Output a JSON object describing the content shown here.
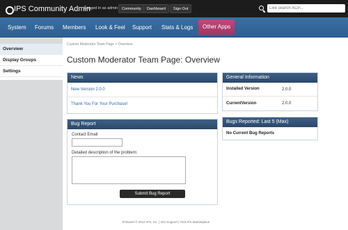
{
  "topbar": {
    "brand": "IPS Community Admin",
    "logged_in": "Logged in as admin",
    "buttons": [
      "Community",
      "Dashboard",
      "Sign Out"
    ],
    "search_placeholder": "Live search ACP..."
  },
  "nav": {
    "items": [
      "System",
      "Forums",
      "Members",
      "Look & Feel",
      "Support",
      "Stats & Logs",
      "Other Apps"
    ],
    "active": "Other Apps"
  },
  "sidebar": {
    "items": [
      "Overview",
      "Display Groups",
      "Settings"
    ]
  },
  "breadcrumb": "Custom Moderator Team Page  >  Overview",
  "page_title": "Custom Moderator Team Page: Overview",
  "news": {
    "title": "News",
    "items": [
      "New Version 2.0.0",
      "Thank You For Your Purchase!"
    ]
  },
  "general_info": {
    "title": "General Information",
    "rows": [
      {
        "label": "Installed Version",
        "value": "2.0.0"
      },
      {
        "label": "CurrentVersion",
        "value": "2.0.0"
      }
    ]
  },
  "bug_report": {
    "title": "Bug Report",
    "email_label": "Contact Email",
    "description_label": "Detailed description of the problem:",
    "submit_label": "Submit Bug Report"
  },
  "bugs_reported": {
    "title": "Bugs Reported: Last 5 (Max)",
    "empty_text": "No Current Bug Reports"
  },
  "footer": "IP.Board © 2012 IPS, Inc.   |   Get Support   |   Visit IPS Marketplace",
  "colors": {
    "topbar": "#1c1c1c",
    "nav": "#2e5f92",
    "nav_active": "#a33561",
    "panel_head": "#2b4869",
    "link": "#2f6aa5"
  }
}
